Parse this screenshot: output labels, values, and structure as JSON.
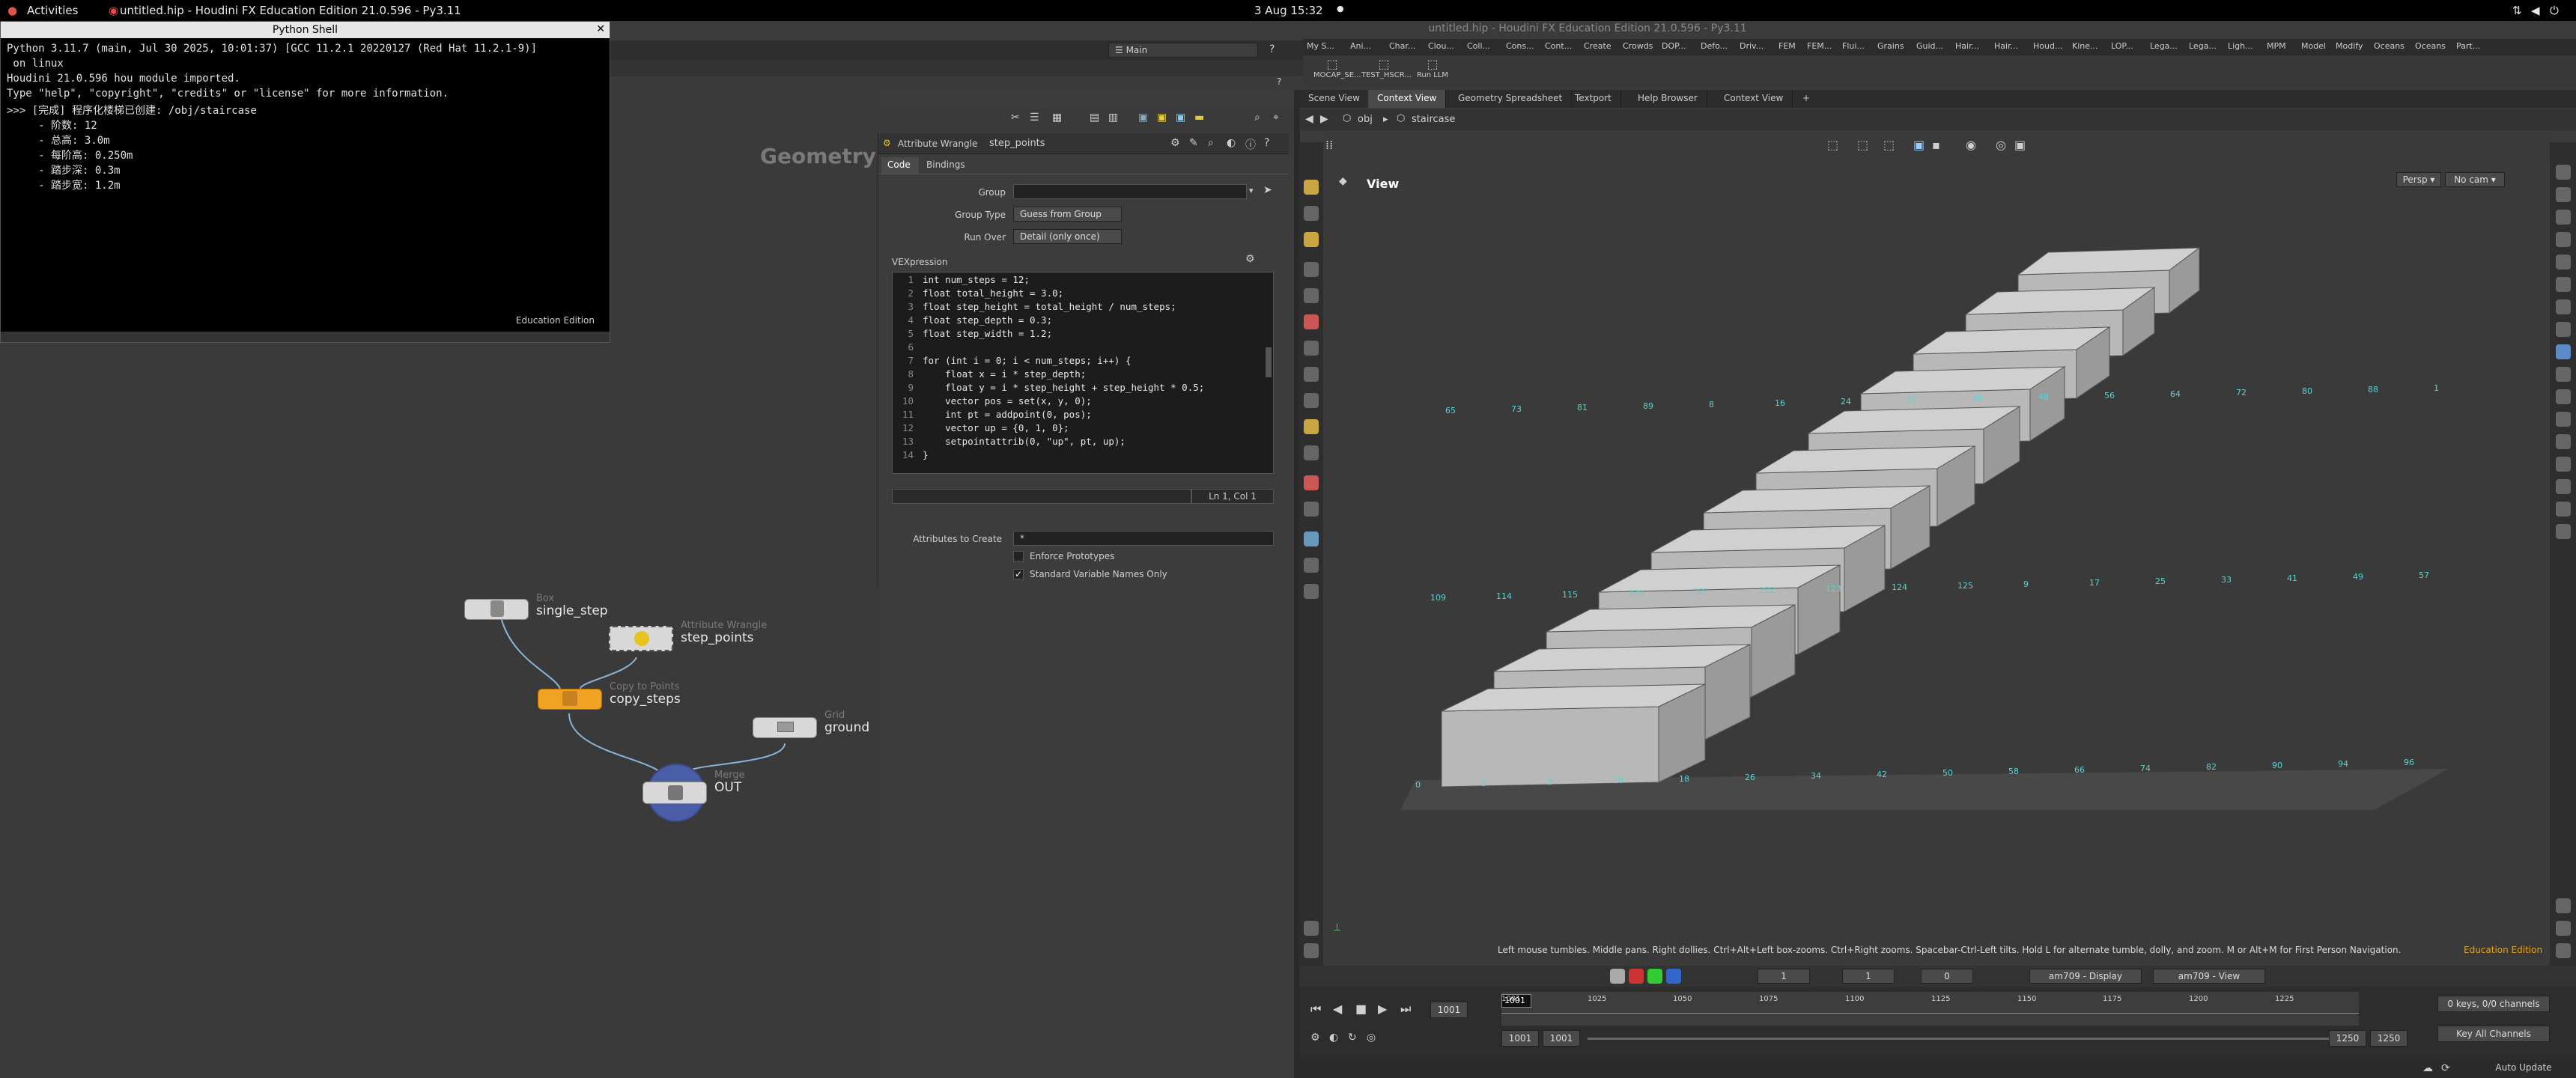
{
  "topbar": {
    "activities": "Activities",
    "window_title": "untitled.hip - Houdini FX Education Edition 21.0.596 - Py3.11",
    "clock": "3 Aug 15:32"
  },
  "app_title": "untitled.hip - Houdini FX Education Edition 21.0.596 - Py3.11",
  "desktop_label": "Main",
  "shelf_tools": [
    "My S...",
    "Ani...",
    "Char...",
    "Clou...",
    "Coll...",
    "Cons...",
    "Cont...",
    "Create",
    "Crowds",
    "DOP...",
    "Defo...",
    "Driv...",
    "FEM",
    "FEM...",
    "Flui...",
    "Grains",
    "Guid...",
    "Hair...",
    "Hair...",
    "Houd...",
    "Kine...",
    "LOP...",
    "Lega...",
    "Lega...",
    "Ligh...",
    "MPM",
    "Model",
    "Modify",
    "Oceans",
    "Oceans",
    "Part..."
  ],
  "shelf_buttons": [
    "MOCAP_SE...",
    "TEST_HSCR...",
    "Run LLM"
  ],
  "viewer_tabs": [
    "Scene View",
    "Context View",
    "Geometry Spreadsheet",
    "Textport",
    "Help Browser",
    "Context View"
  ],
  "viewer_path": {
    "root": "obj",
    "node": "staircase"
  },
  "python_shell": {
    "title": "Python Shell",
    "lines": [
      "Python 3.11.7 (main, Jul 30 2025, 10:01:37) [GCC 11.2.1 20220127 (Red Hat 11.2.1-9)]",
      " on linux",
      "Houdini 21.0.596 hou module imported.",
      "Type \"help\", \"copyright\", \"credits\" or \"license\" for more information.",
      ">>> [完成] 程序化楼梯已创建: /obj/staircase",
      "     - 阶数: 12",
      "     - 总高: 3.0m",
      "     - 每阶高: 0.250m",
      "     - 踏步深: 0.3m",
      "     - 踏步宽: 1.2m"
    ],
    "edition": "Education Edition"
  },
  "network": {
    "context_label": "Geometry",
    "nodes": [
      {
        "type": "Box",
        "name": "single_step"
      },
      {
        "type": "Attribute Wrangle",
        "name": "step_points"
      },
      {
        "type": "Copy to Points",
        "name": "copy_steps"
      },
      {
        "type": "Grid",
        "name": "ground"
      },
      {
        "type": "Merge",
        "name": "OUT"
      }
    ]
  },
  "params": {
    "node_type": "Attribute Wrangle",
    "node_name": "step_points",
    "tabs": [
      "Code",
      "Bindings"
    ],
    "group_label": "Group",
    "group_type_label": "Group Type",
    "group_type_value": "Guess from Group",
    "run_over_label": "Run Over",
    "run_over_value": "Detail (only once)",
    "vex_label": "VEXpression",
    "code_lines": [
      "int num_steps = 12;",
      "float total_height = 3.0;",
      "float step_height = total_height / num_steps;",
      "float step_depth = 0.3;",
      "float step_width = 1.2;",
      "",
      "for (int i = 0; i < num_steps; i++) {",
      "    float x = i * step_depth;",
      "    float y = i * step_height + step_height * 0.5;",
      "    vector pos = set(x, y, 0);",
      "    int pt = addpoint(0, pos);",
      "    vector up = {0, 1, 0};",
      "    setpointattrib(0, \"up\", pt, up);",
      "}"
    ],
    "cursor_pos": "Ln 1, Col 1",
    "attr_create_label": "Attributes to Create",
    "attr_create_value": "*",
    "enforce_prototypes": "Enforce Prototypes",
    "standard_names": "Standard Variable Names Only"
  },
  "viewport": {
    "label": "View",
    "persp": "Persp",
    "cam": "No cam",
    "hint": "Left mouse tumbles. Middle pans. Right dollies. Ctrl+Alt+Left box-zooms. Ctrl+Right zooms. Spacebar-Ctrl-Left tilts. Hold L for alternate tumble, dolly, and zoom. M or Alt+M for First Person Navigation.",
    "edition": "Education Edition",
    "point_numbers": [
      "0",
      "3",
      "2",
      "10",
      "18",
      "26",
      "34",
      "42",
      "50",
      "58",
      "66",
      "74",
      "82",
      "90",
      "94",
      "96",
      "109",
      "114",
      "115",
      "120",
      "121",
      "122",
      "123",
      "124",
      "125",
      "9",
      "17",
      "25",
      "33",
      "41",
      "49",
      "57",
      "65",
      "73",
      "81",
      "89",
      "8",
      "16",
      "24",
      "32",
      "40",
      "48",
      "56",
      "64",
      "72",
      "80",
      "88",
      "1"
    ]
  },
  "display_opts": {
    "display": "am709 - Display",
    "view": "am709 - View",
    "frame_a": "1",
    "frame_b": "1",
    "frame_c": "0"
  },
  "timeline": {
    "frame": "1001",
    "ticks": [
      "1001",
      "1025",
      "1050",
      "1075",
      "1100",
      "1125",
      "1150",
      "1175",
      "1200",
      "1225"
    ],
    "start": "1001",
    "start2": "1001",
    "end": "1250",
    "end2": "1250",
    "keys": "0 keys, 0/0 channels",
    "key_all": "Key All Channels",
    "auto_update": "Auto Update"
  }
}
